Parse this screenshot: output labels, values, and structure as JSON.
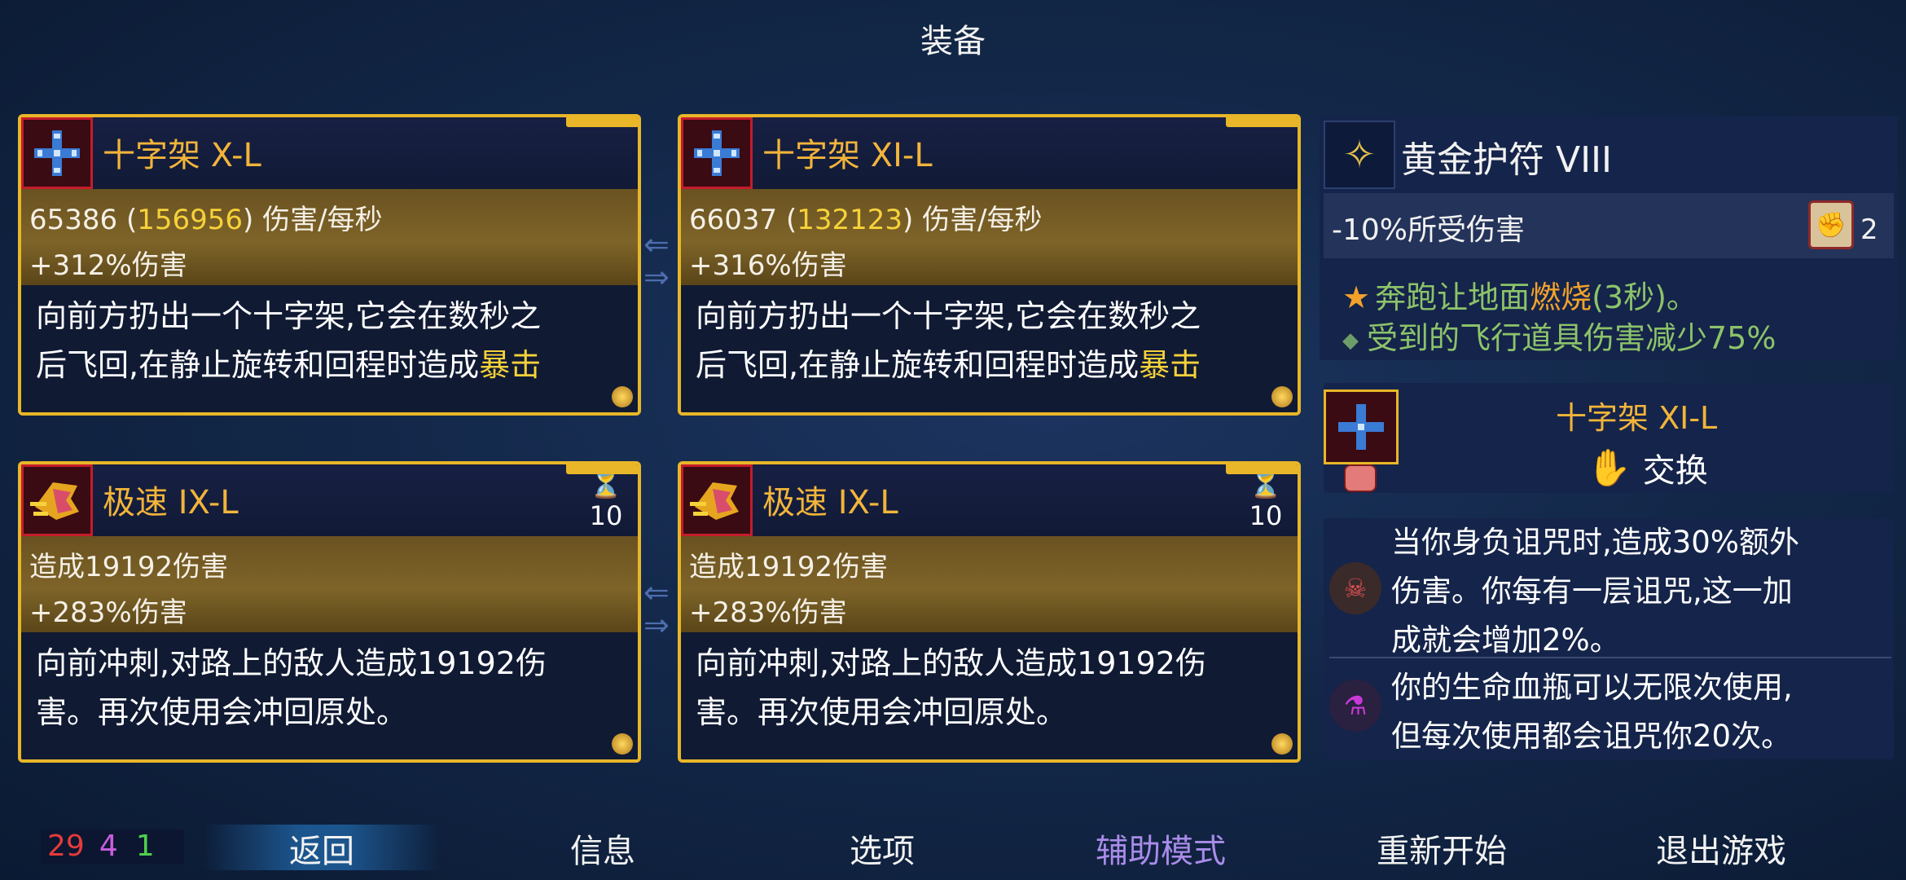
{
  "title": "装备",
  "cards": [
    {
      "name": "十字架 X-L",
      "icon": "cross-icon",
      "stat1_value": "65386 (",
      "stat1_crit": "156956",
      "stat1_unit": ") 伤害/每秒",
      "stat2": "+312%伤害",
      "desc_line1": "向前方扔出一个十字架,它会在数秒之",
      "desc_line2_a": "后飞回,在静止旋转和回程时造成",
      "desc_line2_b": "暴击"
    },
    {
      "name": "十字架 XI-L",
      "icon": "cross-icon",
      "stat1_value": "66037 (",
      "stat1_crit": "132123",
      "stat1_unit": ") 伤害/每秒",
      "stat2": "+316%伤害",
      "desc_line1": "向前方扔出一个十字架,它会在数秒之",
      "desc_line2_a": "后飞回,在静止旋转和回程时造成",
      "desc_line2_b": "暴击"
    },
    {
      "name": "极速 IX-L",
      "icon": "dash-icon",
      "cooldown": "10",
      "stat1": "造成19192伤害",
      "stat2": "+283%伤害",
      "desc_line1": "向前冲刺,对路上的敌人造成19192伤",
      "desc_line2": "害。再次使用会冲回原处。"
    },
    {
      "name": "极速 IX-L",
      "icon": "dash-icon",
      "cooldown": "10",
      "stat1": "造成19192伤害",
      "stat2": "+283%伤害",
      "desc_line1": "向前冲刺,对路上的敌人造成19192伤",
      "desc_line2": "害。再次使用会冲回原处。"
    }
  ],
  "amulet": {
    "name": "黄金护符 VIII",
    "stat": "-10%所受伤害",
    "scroll_count": "2",
    "bonus1_a": "奔跑让地面",
    "bonus1_burn": "燃烧",
    "bonus1_b": "(3秒)。",
    "bonus2": "受到的飞行道具伤害减少75%"
  },
  "swap": {
    "weapon_name": "十字架 XI-L",
    "action_label": "交换"
  },
  "curses": {
    "curse1_line1": "当你身负诅咒时,造成30%额外",
    "curse1_line2": "伤害。你每有一层诅咒,这一加",
    "curse1_line3": "成就会增加2%。",
    "curse2_line1": "你的生命血瓶可以无限次使用,",
    "curse2_line2": "但每次使用都会诅咒你20次。"
  },
  "counters": {
    "red": "29",
    "purple": "4",
    "green": "1"
  },
  "menu": {
    "back": "返回",
    "info": "信息",
    "options": "选项",
    "assist": "辅助模式",
    "restart": "重新开始",
    "quit": "退出游戏"
  },
  "colors": {
    "gold_border": "#e8b628",
    "name_gold": "#f2b43a",
    "bonus_green": "#8cc36a",
    "assist_purple": "#a98be8"
  }
}
